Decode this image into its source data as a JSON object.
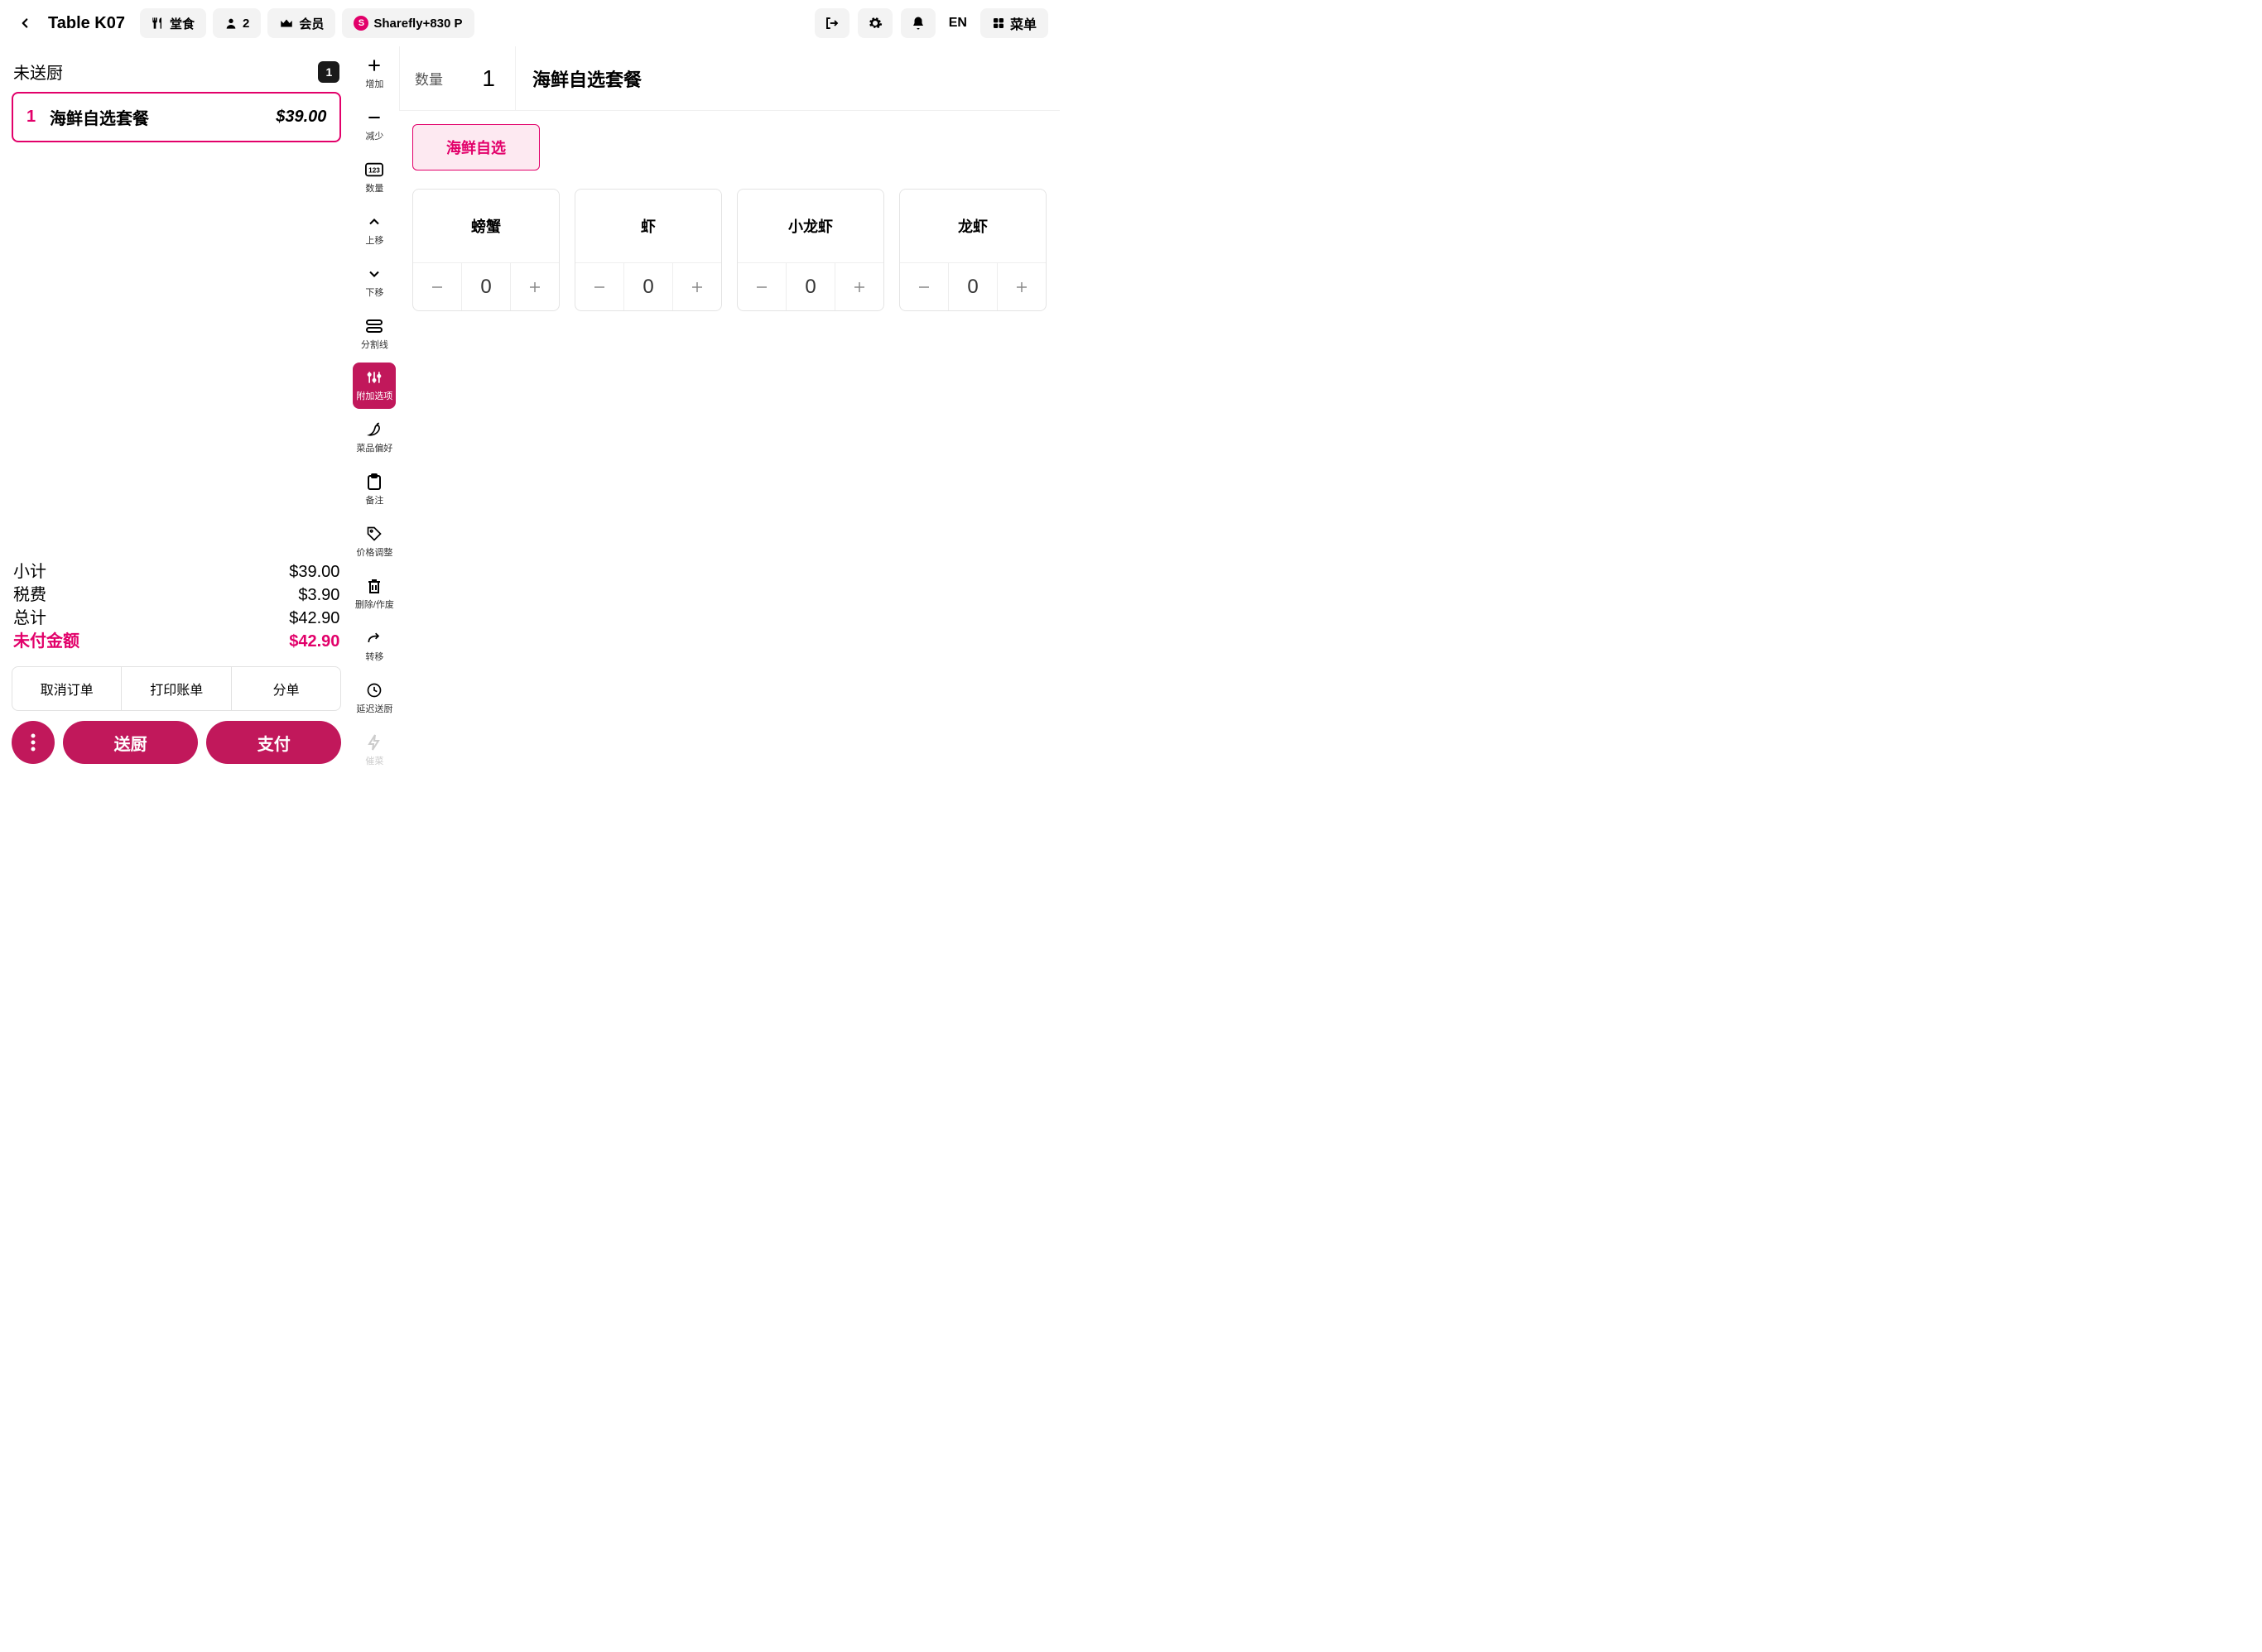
{
  "header": {
    "title": "Table K07",
    "dine_in": "堂食",
    "guests": "2",
    "member": "会员",
    "loyalty": "Sharefly+830 P",
    "lang": "EN",
    "menu": "菜单"
  },
  "order": {
    "section": "未送厨",
    "count": "1",
    "item": {
      "qty": "1",
      "name": "海鲜自选套餐",
      "price": "$39.00"
    },
    "summary": {
      "subtotal_l": "小计",
      "subtotal_v": "$39.00",
      "tax_l": "税费",
      "tax_v": "$3.90",
      "total_l": "总计",
      "total_v": "$42.90",
      "due_l": "未付金额",
      "due_v": "$42.90"
    },
    "actions1": {
      "cancel": "取消订单",
      "print": "打印账单",
      "split": "分单"
    },
    "actions2": {
      "send": "送厨",
      "pay": "支付"
    }
  },
  "tools": {
    "increase": "增加",
    "decrease": "减少",
    "qty": "数量",
    "up": "上移",
    "down": "下移",
    "divider": "分割线",
    "addon": "附加选项",
    "pref": "菜品偏好",
    "note": "备注",
    "price": "价格调整",
    "delete": "删除/作废",
    "transfer": "转移",
    "delay": "延迟送厨",
    "rush": "催菜"
  },
  "detail": {
    "qty_label": "数量",
    "qty_val": "1",
    "name": "海鲜自选套餐",
    "option_tab": "海鲜自选",
    "choices": [
      {
        "name": "螃蟹",
        "val": "0"
      },
      {
        "name": "虾",
        "val": "0"
      },
      {
        "name": "小龙虾",
        "val": "0"
      },
      {
        "name": "龙虾",
        "val": "0"
      }
    ]
  }
}
